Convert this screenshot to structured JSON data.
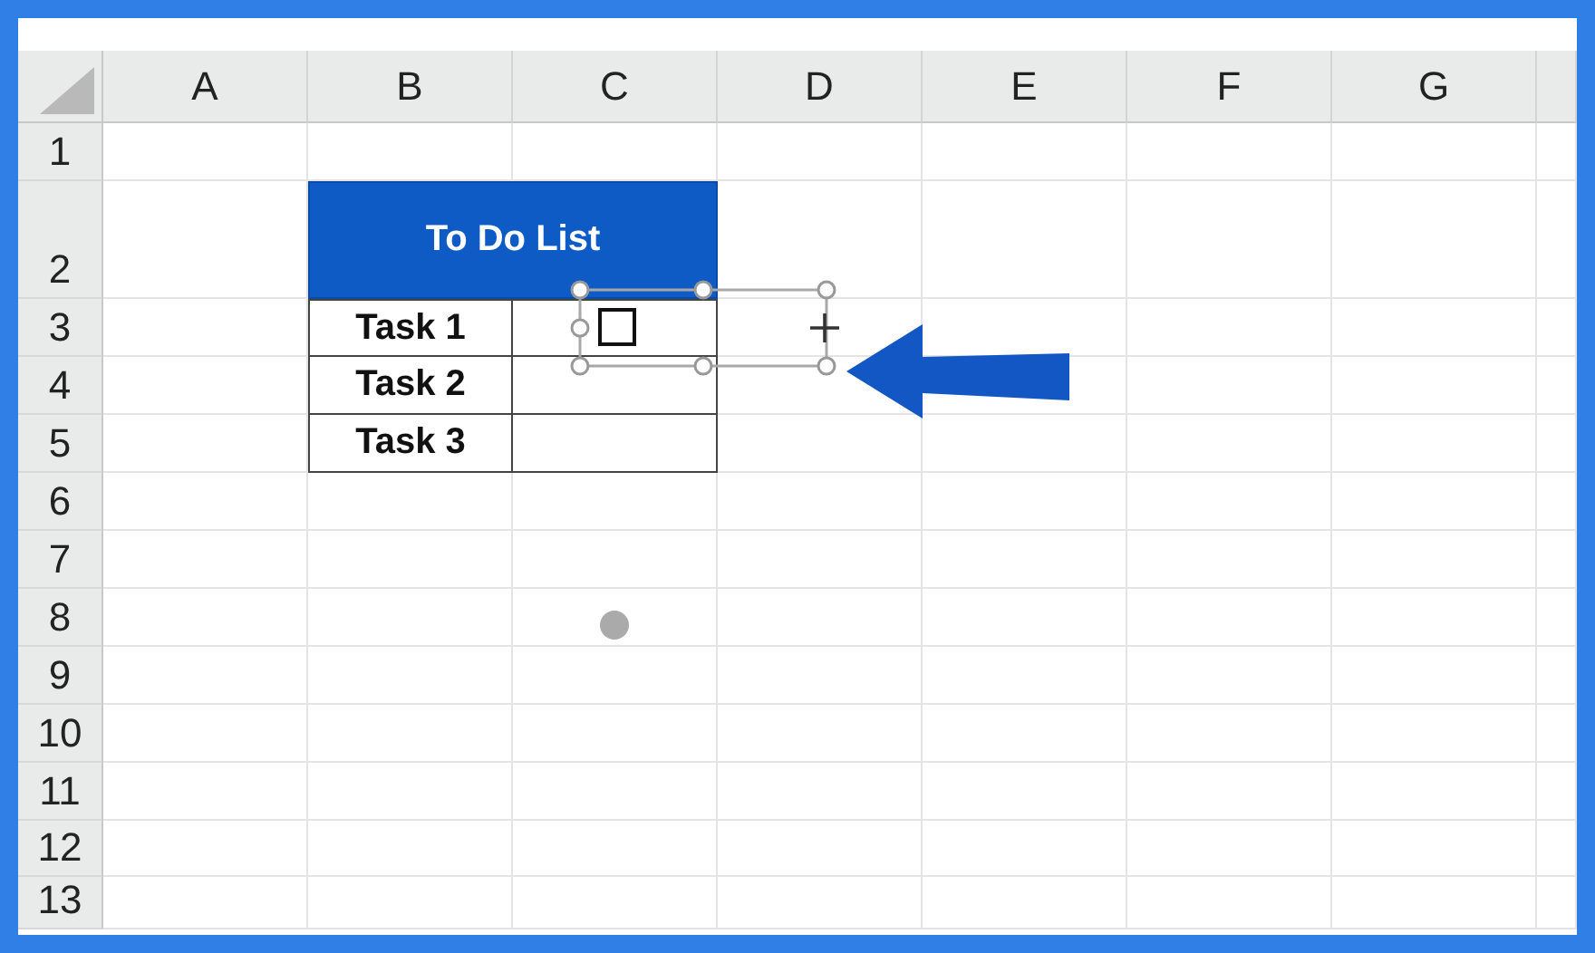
{
  "columns": [
    "A",
    "B",
    "C",
    "D",
    "E",
    "F",
    "G"
  ],
  "rows": [
    "1",
    "2",
    "3",
    "4",
    "5",
    "6",
    "7",
    "8",
    "9",
    "10",
    "11",
    "12",
    "13"
  ],
  "todo": {
    "title": "To Do List",
    "tasks": [
      {
        "label": "Task 1",
        "checkbox": {
          "checked": false,
          "selected": true
        }
      },
      {
        "label": "Task 2"
      },
      {
        "label": "Task 3"
      }
    ]
  }
}
